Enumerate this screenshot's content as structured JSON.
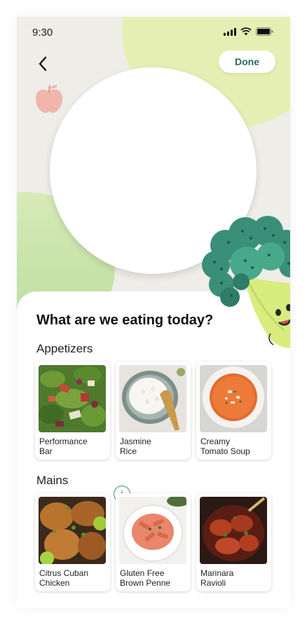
{
  "status_bar": {
    "time": "9:30"
  },
  "header": {
    "done_label": "Done"
  },
  "sheet": {
    "title": "What are we eating today?",
    "sections": [
      {
        "title": "Appetizers",
        "items": [
          {
            "label": "Performance\nBar"
          },
          {
            "label": "Jasmine\nRice"
          },
          {
            "label": "Creamy\nTomato Soup"
          }
        ]
      },
      {
        "title": "Mains",
        "items": [
          {
            "label": "Citrus Cuban\nChicken"
          },
          {
            "label": "Gluten Free\nBrown Penne"
          },
          {
            "label": "Marinara\nRavioli"
          }
        ]
      }
    ],
    "info_badge": "i"
  },
  "icons": {
    "back": "chevron-left-icon",
    "apple": "apple-icon",
    "mascot": "broccoli-mascot-icon"
  },
  "colors": {
    "accent": "#2c6a5f",
    "background": "#eeede8"
  }
}
